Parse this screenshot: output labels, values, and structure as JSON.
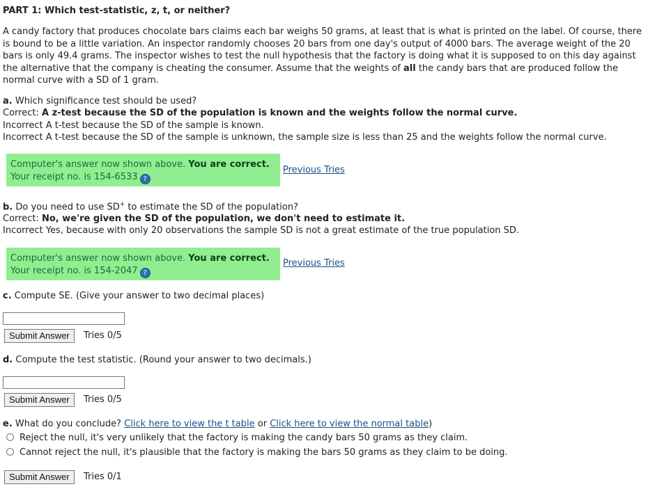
{
  "part_title": "PART 1: Which test-statistic, z, t, or neither?",
  "problem": {
    "text_before_bold": "A candy factory that produces chocolate bars claims each bar weighs 50 grams, at least that is what is printed on the label. Of course, there is bound to be a little variation. An inspector randomly chooses 20 bars from one day's output of 4000 bars. The average weight of the 20 bars is only 49.4 grams. The inspector wishes to test the null hypothesis that the factory is doing what it is supposed to on this day against the alternative that the company is cheating the consumer. Assume that the weights of ",
    "bold_word": "all",
    "text_after_bold": " the candy bars that are produced follow the normal curve with a SD of 1 gram."
  },
  "part_a": {
    "label": "a.",
    "question": "Which significance test should be used?",
    "correct_prefix": "Correct:",
    "correct_text": "A z-test because the SD of the population is known and the weights follow the normal curve.",
    "incorrect_1": "Incorrect A t-test because the SD of the sample is known.",
    "incorrect_2": "Incorrect A t-test because the SD of the sample is unknown, the sample size is less than 25 and the weights follow the normal curve.",
    "status_text": "Computer's answer now shown above.",
    "status_strong": "You are correct.",
    "receipt": "Your receipt no. is 154-6533",
    "previous_tries": "Previous Tries"
  },
  "part_b": {
    "label": "b.",
    "question_before_sup": "Do you need to use SD",
    "question_sup": "+",
    "question_after_sup": " to estimate the SD of the population?",
    "correct_prefix": "Correct:",
    "correct_text": "No, we're given the SD of the population, we don't need to estimate it.",
    "incorrect_1": "Incorrect Yes, because with only 20 observations the sample SD is not a great estimate of the true population SD.",
    "status_text": "Computer's answer now shown above.",
    "status_strong": "You are correct.",
    "receipt": "Your receipt no. is 154-2047",
    "previous_tries": "Previous Tries"
  },
  "part_c": {
    "label": "c.",
    "question": "Compute SE. (Give your answer to two decimal places)",
    "input_value": "",
    "submit_label": "Submit Answer",
    "tries": "Tries 0/5"
  },
  "part_d": {
    "label": "d.",
    "question": "Compute the test statistic. (Round your answer to two decimals.)",
    "input_value": "",
    "submit_label": "Submit Answer",
    "tries": "Tries 0/5"
  },
  "part_e": {
    "label": "e.",
    "question": "What do you conclude?",
    "link_t_table": "Click here to view the t table",
    "or_text": "or",
    "link_normal_table": "Click here to view the normal table",
    "close_paren": ")",
    "option_1": "Reject the null, it's very unlikely that the factory is making the candy bars 50 grams as they claim.",
    "option_2": "Cannot reject the null, it's plausible that the factory is making the bars 50 grams as they claim to be doing.",
    "submit_label": "Submit Answer",
    "tries": "Tries 0/1"
  },
  "help_icon_glyph": "?"
}
